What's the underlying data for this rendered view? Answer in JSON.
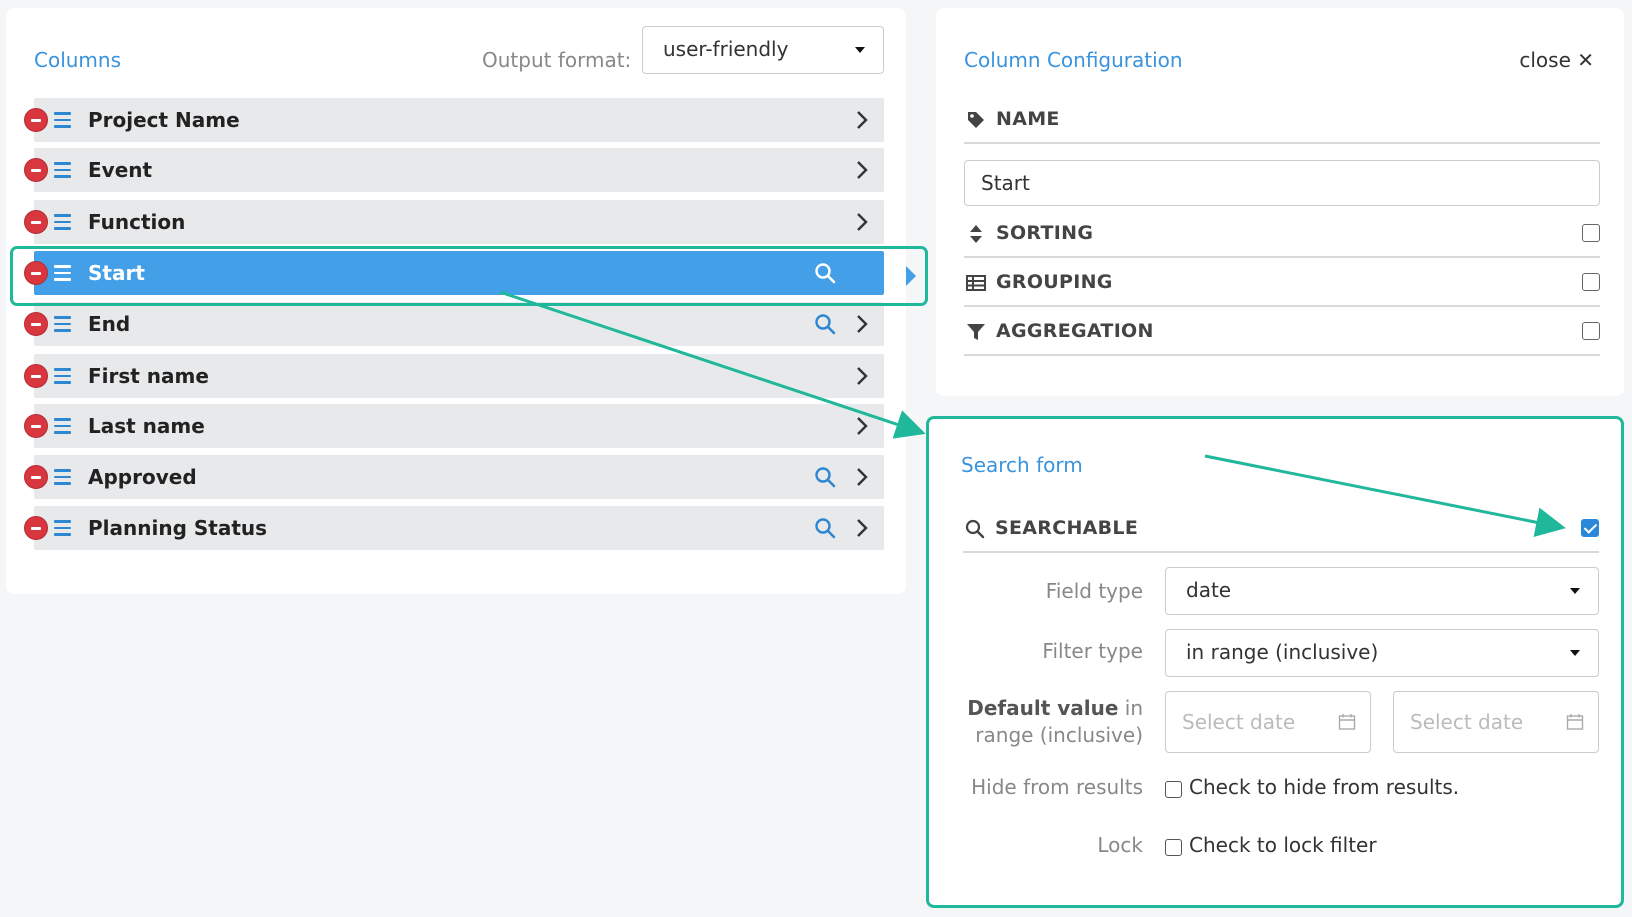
{
  "columns_panel": {
    "title": "Columns",
    "output_format_label": "Output format:",
    "output_format_value": "user-friendly",
    "rows": [
      {
        "label": "Project Name",
        "searchable": false,
        "active": false
      },
      {
        "label": "Event",
        "searchable": false,
        "active": false
      },
      {
        "label": "Function",
        "searchable": false,
        "active": false
      },
      {
        "label": "Start",
        "searchable": true,
        "active": true
      },
      {
        "label": "End",
        "searchable": true,
        "active": false
      },
      {
        "label": "First name",
        "searchable": false,
        "active": false
      },
      {
        "label": "Last name",
        "searchable": false,
        "active": false
      },
      {
        "label": "Approved",
        "searchable": true,
        "active": false
      },
      {
        "label": "Planning Status",
        "searchable": true,
        "active": false
      }
    ]
  },
  "config_panel": {
    "title": "Column Configuration",
    "close_label": "close",
    "name_label": "NAME",
    "name_value": "Start",
    "sorting_label": "SORTING",
    "sorting_checked": false,
    "grouping_label": "GROUPING",
    "grouping_checked": false,
    "aggregation_label": "AGGREGATION",
    "aggregation_checked": false
  },
  "search_form": {
    "title": "Search form",
    "searchable_label": "SEARCHABLE",
    "searchable_checked": true,
    "field_type_label": "Field type",
    "field_type_value": "date",
    "filter_type_label": "Filter type",
    "filter_type_value": "in range (inclusive)",
    "default_value_label_bold": "Default value",
    "default_value_label_in": " in",
    "default_value_label_rest": "range (inclusive)",
    "date_from_placeholder": "Select date",
    "date_to_placeholder": "Select date",
    "hide_label": "Hide from results",
    "hide_text": "Check to hide from results.",
    "lock_label": "Lock",
    "lock_text": "Check to lock filter"
  },
  "colors": {
    "accent": "#3a93dd",
    "highlight": "#20b89a",
    "active_row": "#43a0e8",
    "remove": "#d8373f"
  }
}
